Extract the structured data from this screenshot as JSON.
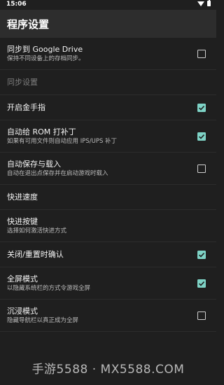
{
  "status": {
    "time": "15:06"
  },
  "app": {
    "title": "程序设置"
  },
  "settings": [
    {
      "title": "同步到 Google Drive",
      "subtitle": "保持不同设备上的存档同步。",
      "checked": false
    },
    {
      "header": "同步设置"
    },
    {
      "title": "开启金手指",
      "checked": true
    },
    {
      "title": "自动给 ROM 打补丁",
      "subtitle": "如果有可用文件则自动应用 IPS/UPS 补丁",
      "checked": true
    },
    {
      "title": "自动保存与载入",
      "subtitle": "自动在退出点保存并在启动游戏时载入",
      "checked": false
    },
    {
      "title": "快进速度"
    },
    {
      "title": "快进按键",
      "subtitle": "选择如何激活快进方式"
    },
    {
      "title": "关闭/重置时确认",
      "checked": true
    },
    {
      "title": "全屏模式",
      "subtitle": "以隐藏系统栏的方式令游戏全屏",
      "checked": true
    },
    {
      "title": "沉浸模式",
      "subtitle": "隐藏导航栏以真正成为全屏",
      "checked": false
    }
  ],
  "watermark": "手游5588 · MX5588.COM",
  "colors": {
    "accent": "#7ed3c6",
    "background": "#1f1f1f",
    "appbar": "#2d2d2d"
  }
}
